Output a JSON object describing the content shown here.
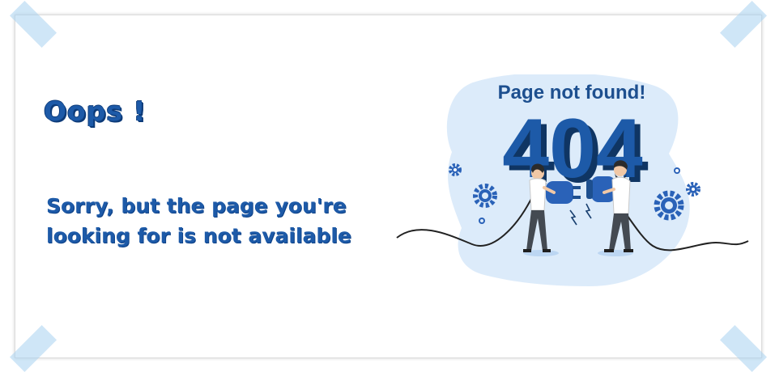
{
  "heading": "Oops !",
  "message": "Sorry, but the page you're looking for is not available",
  "illustration": {
    "caption": "Page not found!",
    "code": "404"
  },
  "colors": {
    "primary": "#1d5aa8",
    "dark": "#183f6f",
    "blob": "#dcebfa",
    "tape": "#a8d2f0"
  }
}
